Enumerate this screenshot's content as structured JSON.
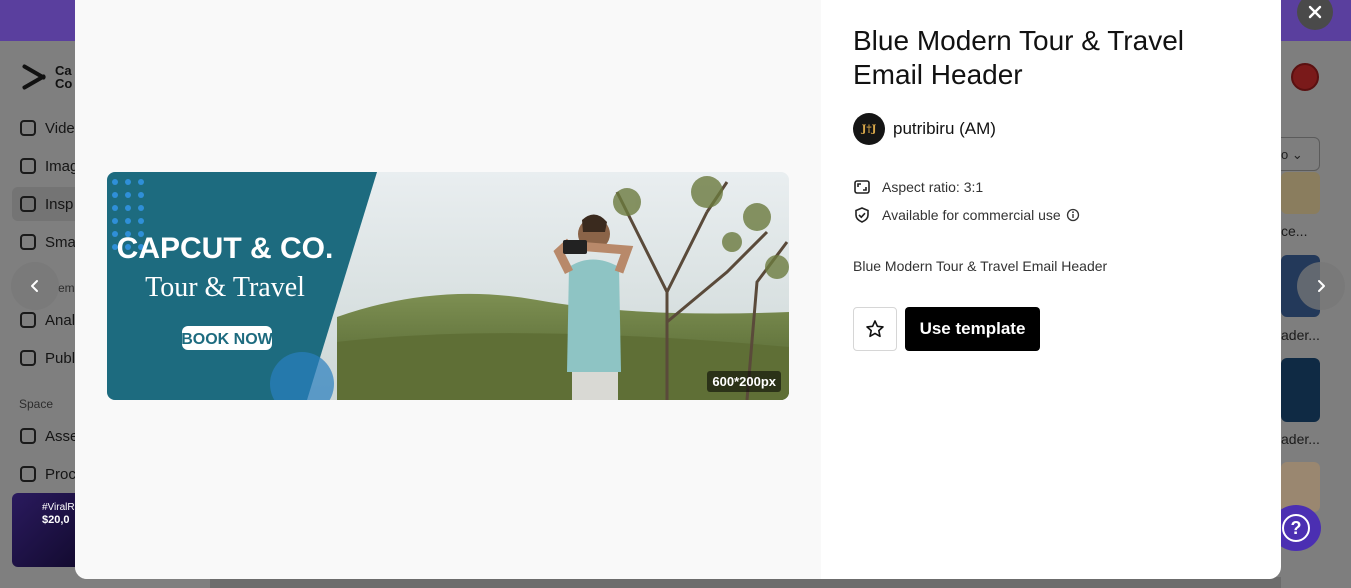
{
  "background": {
    "logo_text_line1": "Ca",
    "logo_text_line2": "Co",
    "nav": [
      {
        "label": "Vide"
      },
      {
        "label": "Imag"
      },
      {
        "label": "Insp"
      },
      {
        "label": "Sma"
      },
      {
        "label": "Anal"
      },
      {
        "label": "Publ"
      },
      {
        "label": "Asse"
      },
      {
        "label": "Proc"
      }
    ],
    "section_template": "em",
    "section_space": "Space",
    "promo_line1": "#ViralR",
    "promo_line2": "$20,0",
    "right_select": "o",
    "right_labels": [
      "ce...",
      "ader...",
      "ader..."
    ]
  },
  "modal": {
    "title": "Blue Modern Tour & Travel Email Header",
    "author": {
      "name": "putribiru (AM)",
      "avatar_text": "lokep"
    },
    "aspect_ratio": "Aspect ratio: 3:1",
    "commercial": "Available for commercial use",
    "description": "Blue Modern Tour & Travel Email Header",
    "use_button": "Use template",
    "preview": {
      "brand": "CAPCUT & CO.",
      "tagline": "Tour & Travel",
      "cta": "BOOK NOW",
      "size_badge": "600*200px"
    }
  },
  "colors": {
    "banner_teal": "#1d6b7f",
    "button_black": "#000000",
    "help_purple": "#4b2fb2",
    "topbar_purple": "#5a3f9e"
  },
  "icons": [
    "close-icon",
    "chevron-left-icon",
    "chevron-right-icon",
    "aspect-ratio-icon",
    "shield-check-icon",
    "info-icon",
    "star-icon",
    "help-icon"
  ]
}
